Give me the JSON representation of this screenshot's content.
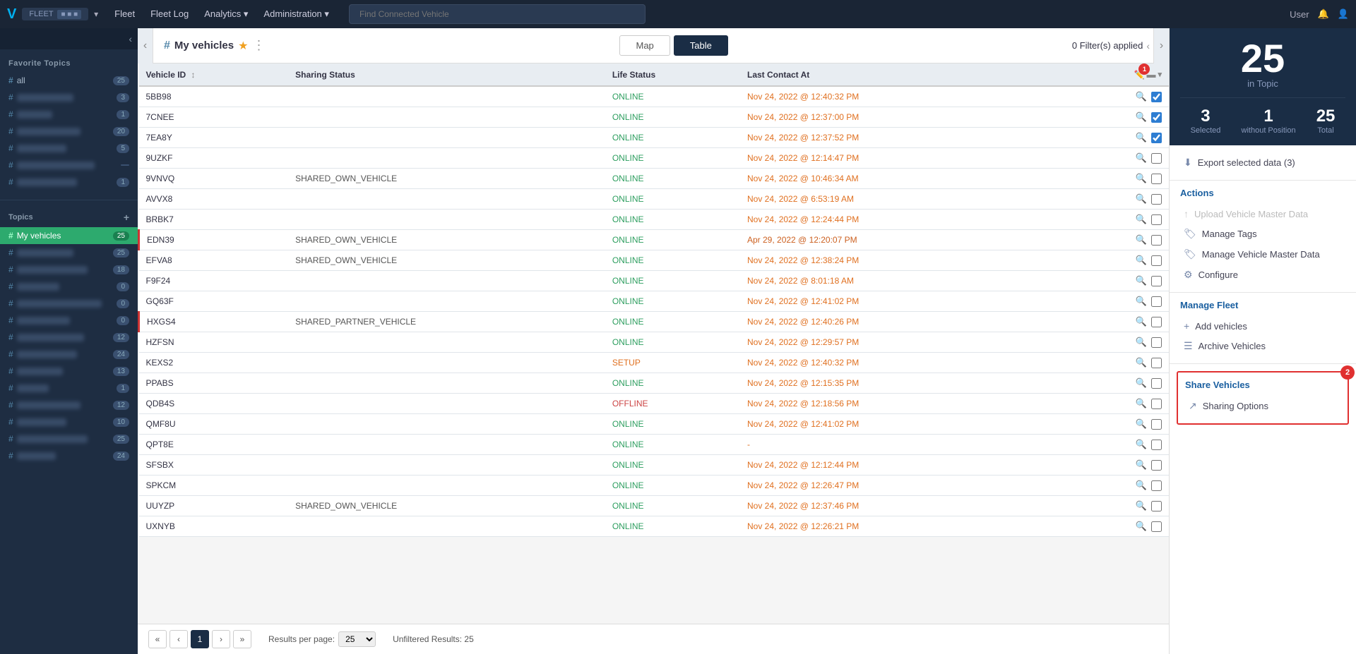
{
  "app": {
    "logo_text": "V",
    "fleet_badge": "FLEET",
    "nav_dropdown_label": "▾"
  },
  "nav": {
    "links": [
      "Fleet",
      "Fleet Log",
      "Analytics ▾",
      "Administration ▾"
    ],
    "search_placeholder": "Find Connected Vehicle",
    "user_label": "User"
  },
  "sidebar": {
    "favorite_topics_title": "Favorite Topics",
    "topics_title": "Topics",
    "add_icon": "+",
    "favorite_items": [
      {
        "hash": "#",
        "label": "all",
        "count": "25",
        "blurred": false
      },
      {
        "hash": "#",
        "label": "blurred1",
        "count": "3",
        "blurred": true
      },
      {
        "hash": "#",
        "label": "blurred2",
        "count": "1",
        "blurred": true
      },
      {
        "hash": "#",
        "label": "blurred3",
        "count": "20",
        "blurred": true
      },
      {
        "hash": "#",
        "label": "blurred4",
        "count": "5",
        "blurred": true
      },
      {
        "hash": "#",
        "label": "blurred5",
        "count": "",
        "blurred": true
      },
      {
        "hash": "#",
        "label": "blurred6",
        "count": "1",
        "blurred": true
      }
    ],
    "topic_items": [
      {
        "hash": "#",
        "label": "My vehicles",
        "count": "25",
        "active": true,
        "blurred": false
      },
      {
        "hash": "#",
        "label": "blurred",
        "count": "25",
        "blurred": true
      },
      {
        "hash": "#",
        "label": "blurred",
        "count": "18",
        "blurred": true
      },
      {
        "hash": "#",
        "label": "blurred",
        "count": "0",
        "blurred": true
      },
      {
        "hash": "#",
        "label": "blurred",
        "count": "0",
        "blurred": true
      },
      {
        "hash": "#",
        "label": "blurred",
        "count": "0",
        "blurred": true
      },
      {
        "hash": "#",
        "label": "blurred",
        "count": "12",
        "blurred": true
      },
      {
        "hash": "#",
        "label": "blurred",
        "count": "24",
        "blurred": true
      },
      {
        "hash": "#",
        "label": "blurred",
        "count": "13",
        "blurred": true
      },
      {
        "hash": "#",
        "label": "blurred",
        "count": "1",
        "blurred": true
      },
      {
        "hash": "#",
        "label": "blurred",
        "count": "12",
        "blurred": true
      },
      {
        "hash": "#",
        "label": "blurred",
        "count": "10",
        "blurred": true
      },
      {
        "hash": "#",
        "label": "blurred",
        "count": "25",
        "blurred": true
      },
      {
        "hash": "#",
        "label": "blurred",
        "count": "24",
        "blurred": true
      }
    ]
  },
  "subheader": {
    "page_title": "My vehicles",
    "star": "★",
    "dots": "⋮",
    "map_label": "Map",
    "table_label": "Table",
    "filter_text": "0 Filter(s) applied",
    "left_arrow": "‹",
    "right_arrow": "›"
  },
  "table": {
    "columns": [
      "Vehicle ID",
      "Sharing Status",
      "Life Status",
      "Last Contact At"
    ],
    "sort_arrow": "↕",
    "rows": [
      {
        "id": "5BB98",
        "sharing": "",
        "life": "ONLINE",
        "date": "Nov 24, 2022 @ 12:40:32 PM",
        "checked": true,
        "highlighted": false
      },
      {
        "id": "7CNEE",
        "sharing": "",
        "life": "ONLINE",
        "date": "Nov 24, 2022 @ 12:37:00 PM",
        "checked": true,
        "highlighted": false
      },
      {
        "id": "7EA8Y",
        "sharing": "",
        "life": "ONLINE",
        "date": "Nov 24, 2022 @ 12:37:52 PM",
        "checked": true,
        "highlighted": false
      },
      {
        "id": "9UZKF",
        "sharing": "",
        "life": "ONLINE",
        "date": "Nov 24, 2022 @ 12:14:47 PM",
        "checked": false,
        "highlighted": false
      },
      {
        "id": "9VNVQ",
        "sharing": "SHARED_OWN_VEHICLE",
        "life": "ONLINE",
        "date": "Nov 24, 2022 @ 10:46:34 AM",
        "checked": false,
        "highlighted": false
      },
      {
        "id": "AVVX8",
        "sharing": "",
        "life": "ONLINE",
        "date": "Nov 24, 2022 @ 6:53:19 AM",
        "checked": false,
        "highlighted": false
      },
      {
        "id": "BRBK7",
        "sharing": "",
        "life": "ONLINE",
        "date": "Nov 24, 2022 @ 12:24:44 PM",
        "checked": false,
        "highlighted": false
      },
      {
        "id": "EDN39",
        "sharing": "SHARED_OWN_VEHICLE",
        "life": "ONLINE",
        "date": "Apr 29, 2022 @ 12:20:07 PM",
        "checked": false,
        "highlighted": true
      },
      {
        "id": "EFVA8",
        "sharing": "SHARED_OWN_VEHICLE",
        "life": "ONLINE",
        "date": "Nov 24, 2022 @ 12:38:24 PM",
        "checked": false,
        "highlighted": false
      },
      {
        "id": "F9F24",
        "sharing": "",
        "life": "ONLINE",
        "date": "Nov 24, 2022 @ 8:01:18 AM",
        "checked": false,
        "highlighted": false
      },
      {
        "id": "GQ63F",
        "sharing": "",
        "life": "ONLINE",
        "date": "Nov 24, 2022 @ 12:41:02 PM",
        "checked": false,
        "highlighted": false
      },
      {
        "id": "HXGS4",
        "sharing": "SHARED_PARTNER_VEHICLE",
        "life": "ONLINE",
        "date": "Nov 24, 2022 @ 12:40:26 PM",
        "checked": false,
        "highlighted": true
      },
      {
        "id": "HZFSN",
        "sharing": "",
        "life": "ONLINE",
        "date": "Nov 24, 2022 @ 12:29:57 PM",
        "checked": false,
        "highlighted": false
      },
      {
        "id": "KEXS2",
        "sharing": "",
        "life": "SETUP",
        "date": "Nov 24, 2022 @ 12:40:32 PM",
        "checked": false,
        "highlighted": false
      },
      {
        "id": "PPABS",
        "sharing": "",
        "life": "ONLINE",
        "date": "Nov 24, 2022 @ 12:15:35 PM",
        "checked": false,
        "highlighted": false
      },
      {
        "id": "QDB4S",
        "sharing": "",
        "life": "OFFLINE",
        "date": "Nov 24, 2022 @ 12:18:56 PM",
        "checked": false,
        "highlighted": false
      },
      {
        "id": "QMF8U",
        "sharing": "",
        "life": "ONLINE",
        "date": "Nov 24, 2022 @ 12:41:02 PM",
        "checked": false,
        "highlighted": false
      },
      {
        "id": "QPT8E",
        "sharing": "",
        "life": "ONLINE",
        "date": "-",
        "checked": false,
        "highlighted": false
      },
      {
        "id": "SFSBX",
        "sharing": "",
        "life": "ONLINE",
        "date": "Nov 24, 2022 @ 12:12:44 PM",
        "checked": false,
        "highlighted": false
      },
      {
        "id": "SPKCM",
        "sharing": "",
        "life": "ONLINE",
        "date": "Nov 24, 2022 @ 12:26:47 PM",
        "checked": false,
        "highlighted": false
      },
      {
        "id": "UUYZP",
        "sharing": "SHARED_OWN_VEHICLE",
        "life": "ONLINE",
        "date": "Nov 24, 2022 @ 12:37:46 PM",
        "checked": false,
        "highlighted": false
      },
      {
        "id": "UXNYB",
        "sharing": "",
        "life": "ONLINE",
        "date": "Nov 24, 2022 @ 12:26:21 PM",
        "checked": false,
        "highlighted": false
      }
    ]
  },
  "pagination": {
    "current_page": "1",
    "results_per_page_label": "Results per page:",
    "per_page_value": "25",
    "unfiltered_results": "Unfiltered Results: 25",
    "first": "«",
    "prev": "‹",
    "next": "›",
    "last": "»"
  },
  "right_panel": {
    "big_number": "25",
    "big_label": "in Topic",
    "selected_count": "3",
    "selected_label": "Selected",
    "without_position_count": "1",
    "without_position_label": "without Position",
    "total_count": "25",
    "total_label": "Total",
    "export_label": "Export selected data (3)",
    "actions_title": "Actions",
    "actions": [
      {
        "label": "Upload Vehicle Master Data",
        "icon": "↑",
        "disabled": true
      },
      {
        "label": "Manage Tags",
        "icon": "🏷",
        "disabled": false
      },
      {
        "label": "Manage Vehicle Master Data",
        "icon": "🏷",
        "disabled": false
      },
      {
        "label": "Configure",
        "icon": "⚙",
        "disabled": false
      }
    ],
    "manage_fleet_title": "Manage Fleet",
    "manage_fleet_items": [
      {
        "label": "Add vehicles",
        "icon": "+",
        "disabled": false
      },
      {
        "label": "Archive Vehicles",
        "icon": "☰",
        "disabled": false
      }
    ],
    "share_vehicles_title": "Share Vehicles",
    "share_vehicles_items": [
      {
        "label": "Sharing Options",
        "icon": "↗",
        "disabled": false
      }
    ]
  }
}
